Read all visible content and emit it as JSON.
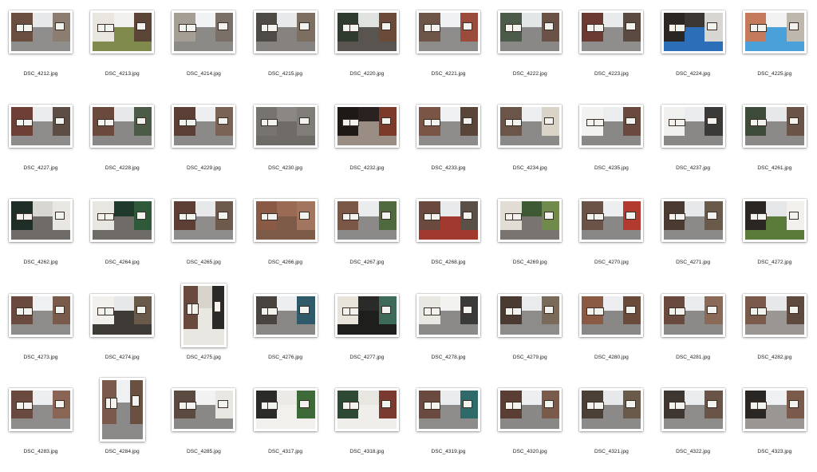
{
  "files": [
    {
      "name": "DSC_4212.jpg",
      "orientation": "landscape",
      "tone": [
        "#e6e8ea",
        "#6a4e40",
        "#8b7d70",
        "#8f8e8c"
      ]
    },
    {
      "name": "DSC_4213.jpg",
      "orientation": "landscape",
      "tone": [
        "#f0f0ee",
        "#e9e6e0",
        "#5b4536",
        "#7f8a4c"
      ]
    },
    {
      "name": "DSC_4214.jpg",
      "orientation": "landscape",
      "tone": [
        "#f1f2f3",
        "#a59e95",
        "#7b7068",
        "#8c8a86"
      ]
    },
    {
      "name": "DSC_4215.jpg",
      "orientation": "landscape",
      "tone": [
        "#e7e9ea",
        "#4e4a46",
        "#7c6e60",
        "#858280"
      ]
    },
    {
      "name": "DSC_4220.jpg",
      "orientation": "landscape",
      "tone": [
        "#dfe2df",
        "#2e3b2e",
        "#6b4a3a",
        "#5a5450"
      ]
    },
    {
      "name": "DSC_4221.jpg",
      "orientation": "landscape",
      "tone": [
        "#eef0f1",
        "#6d5548",
        "#9a4b3c",
        "#8e8c8a"
      ]
    },
    {
      "name": "DSC_4222.jpg",
      "orientation": "landscape",
      "tone": [
        "#e3e6e6",
        "#4c5a4a",
        "#6a5246",
        "#8a8886"
      ]
    },
    {
      "name": "DSC_4223.jpg",
      "orientation": "landscape",
      "tone": [
        "#e8eaec",
        "#6b3b33",
        "#5a4a40",
        "#908e8c"
      ]
    },
    {
      "name": "DSC_4224.jpg",
      "orientation": "landscape",
      "tone": [
        "#3a3632",
        "#2a2624",
        "#d8d6d2",
        "#2c6fb8"
      ]
    },
    {
      "name": "DSC_4225.jpg",
      "orientation": "landscape",
      "tone": [
        "#f2f2f2",
        "#c67a5c",
        "#bdb7ae",
        "#4aa0d8"
      ]
    },
    {
      "name": "DSC_4227.jpg",
      "orientation": "landscape",
      "tone": [
        "#e9ebed",
        "#6d3f35",
        "#5c4e44",
        "#8e8c8a"
      ]
    },
    {
      "name": "DSC_4228.jpg",
      "orientation": "landscape",
      "tone": [
        "#e6e8ea",
        "#6a4a3c",
        "#4c5a48",
        "#8a8886"
      ]
    },
    {
      "name": "DSC_4229.jpg",
      "orientation": "landscape",
      "tone": [
        "#eceef0",
        "#5b3f36",
        "#7a6354",
        "#8c8a88"
      ]
    },
    {
      "name": "DSC_4230.jpg",
      "orientation": "landscape",
      "tone": [
        "#8a8784",
        "#77736f",
        "#807c78",
        "#6f6b67"
      ]
    },
    {
      "name": "DSC_4232.jpg",
      "orientation": "landscape",
      "tone": [
        "#2a2220",
        "#1e1816",
        "#7b3a2a",
        "#9a8e84"
      ]
    },
    {
      "name": "DSC_4233.jpg",
      "orientation": "landscape",
      "tone": [
        "#eef0f2",
        "#7a5444",
        "#5a4638",
        "#8e8c8a"
      ]
    },
    {
      "name": "DSC_4234.jpg",
      "orientation": "landscape",
      "tone": [
        "#eceeef",
        "#6b5448",
        "#d9d3c8",
        "#8c8a88"
      ]
    },
    {
      "name": "DSC_4235.jpg",
      "orientation": "landscape",
      "tone": [
        "#ebedef",
        "#f2f2f0",
        "#6a4a3e",
        "#8a8886"
      ]
    },
    {
      "name": "DSC_4237.jpg",
      "orientation": "landscape",
      "tone": [
        "#e9ebec",
        "#f0f0ee",
        "#3a3a38",
        "#8a8886"
      ]
    },
    {
      "name": "DSC_4261.jpg",
      "orientation": "landscape",
      "tone": [
        "#e6e8ea",
        "#3e4a3a",
        "#6a5448",
        "#8c8a88"
      ]
    },
    {
      "name": "DSC_4262.jpg",
      "orientation": "landscape",
      "tone": [
        "#d8d6d0",
        "#1e2e26",
        "#e9e7e1",
        "#6f6c68"
      ]
    },
    {
      "name": "DSC_4264.jpg",
      "orientation": "landscape",
      "tone": [
        "#1f3a2a",
        "#e8e6e0",
        "#2f5a3a",
        "#6f6c68"
      ]
    },
    {
      "name": "DSC_4265.jpg",
      "orientation": "landscape",
      "tone": [
        "#e6e8ea",
        "#5c3e34",
        "#6e5a4c",
        "#8e8c8a"
      ]
    },
    {
      "name": "DSC_4266.jpg",
      "orientation": "landscape",
      "tone": [
        "#9a6a54",
        "#8a5a46",
        "#a2765e",
        "#7e5a48"
      ]
    },
    {
      "name": "DSC_4267.jpg",
      "orientation": "landscape",
      "tone": [
        "#e9ebec",
        "#7a5646",
        "#4e6a3e",
        "#8c8a88"
      ]
    },
    {
      "name": "DSC_4268.jpg",
      "orientation": "landscape",
      "tone": [
        "#e8eaec",
        "#6a4a3e",
        "#5a5048",
        "#a03a2e"
      ]
    },
    {
      "name": "DSC_4269.jpg",
      "orientation": "landscape",
      "tone": [
        "#3e5a34",
        "#e2ddd4",
        "#6f8a4a",
        "#7a7470"
      ]
    },
    {
      "name": "DSC_4270.jpg",
      "orientation": "landscape",
      "tone": [
        "#eceef0",
        "#6a5448",
        "#b33a2e",
        "#8a8886"
      ]
    },
    {
      "name": "DSC_4271.jpg",
      "orientation": "landscape",
      "tone": [
        "#e6e8ea",
        "#4a3a32",
        "#6a5a4a",
        "#8c8a88"
      ]
    },
    {
      "name": "DSC_4272.jpg",
      "orientation": "landscape",
      "tone": [
        "#e4e6e8",
        "#2a2624",
        "#f2f0ec",
        "#5a7a3a"
      ]
    },
    {
      "name": "DSC_4273.jpg",
      "orientation": "landscape",
      "tone": [
        "#eef0f2",
        "#6a4a3e",
        "#7a5a4a",
        "#8e8c8a"
      ]
    },
    {
      "name": "DSC_4274.jpg",
      "orientation": "landscape",
      "tone": [
        "#e6e8ea",
        "#f2f0ec",
        "#6a5a4a",
        "#3e3a36"
      ]
    },
    {
      "name": "DSC_4275.jpg",
      "orientation": "portrait",
      "tone": [
        "#d8d4cc",
        "#6a4a3e",
        "#2a2a28",
        "#e9e7e2"
      ]
    },
    {
      "name": "DSC_4276.jpg",
      "orientation": "landscape",
      "tone": [
        "#eceef0",
        "#4a4440",
        "#2e5a6a",
        "#8a8886"
      ]
    },
    {
      "name": "DSC_4277.jpg",
      "orientation": "landscape",
      "tone": [
        "#2a2a28",
        "#e8e4dc",
        "#3e6a5a",
        "#1e1e1c"
      ]
    },
    {
      "name": "DSC_4278.jpg",
      "orientation": "landscape",
      "tone": [
        "#f2f2f0",
        "#e9e7e2",
        "#3a3a38",
        "#8c8a88"
      ]
    },
    {
      "name": "DSC_4279.jpg",
      "orientation": "landscape",
      "tone": [
        "#e9ebec",
        "#4a3a32",
        "#7a6a5a",
        "#8e8c8a"
      ]
    },
    {
      "name": "DSC_4280.jpg",
      "orientation": "landscape",
      "tone": [
        "#eceef0",
        "#8a5a44",
        "#6a4a3a",
        "#8a8886"
      ]
    },
    {
      "name": "DSC_4281.jpg",
      "orientation": "landscape",
      "tone": [
        "#e9ebed",
        "#6a4a3e",
        "#8a6a56",
        "#8c8a88"
      ]
    },
    {
      "name": "DSC_4282.jpg",
      "orientation": "landscape",
      "tone": [
        "#e6e8ea",
        "#7a5a4a",
        "#5e4a3e",
        "#9a9694"
      ]
    },
    {
      "name": "DSC_4283.jpg",
      "orientation": "landscape",
      "tone": [
        "#eceef0",
        "#6a4a3e",
        "#8a6454",
        "#8e8c8a"
      ]
    },
    {
      "name": "DSC_4284.jpg",
      "orientation": "portrait",
      "tone": [
        "#eef0f1",
        "#7a5a4a",
        "#6a5040",
        "#8c8a88"
      ]
    },
    {
      "name": "DSC_4285.jpg",
      "orientation": "landscape",
      "tone": [
        "#f2f2f2",
        "#5a4a40",
        "#e9e7e2",
        "#8a8886"
      ]
    },
    {
      "name": "DSC_4317.jpg",
      "orientation": "landscape",
      "tone": [
        "#eceae6",
        "#2a2a28",
        "#3e6a3a",
        "#f2f0ec"
      ]
    },
    {
      "name": "DSC_4318.jpg",
      "orientation": "landscape",
      "tone": [
        "#e8e6e0",
        "#2e4a34",
        "#7a3a30",
        "#f0eeea"
      ]
    },
    {
      "name": "DSC_4319.jpg",
      "orientation": "landscape",
      "tone": [
        "#e9ebec",
        "#6a4a3e",
        "#2e6a6a",
        "#8e8c8a"
      ]
    },
    {
      "name": "DSC_4320.jpg",
      "orientation": "landscape",
      "tone": [
        "#eceef0",
        "#5a3e34",
        "#7a5a4a",
        "#8a8886"
      ]
    },
    {
      "name": "DSC_4321.jpg",
      "orientation": "landscape",
      "tone": [
        "#e6e8ea",
        "#4a4036",
        "#6a5a4a",
        "#8c8a88"
      ]
    },
    {
      "name": "DSC_4322.jpg",
      "orientation": "landscape",
      "tone": [
        "#e9ebed",
        "#3e3630",
        "#6a5448",
        "#8e8c8a"
      ]
    },
    {
      "name": "DSC_4323.jpg",
      "orientation": "landscape",
      "tone": [
        "#eef0f2",
        "#2a2624",
        "#7a5a4a",
        "#9a9694"
      ]
    }
  ]
}
